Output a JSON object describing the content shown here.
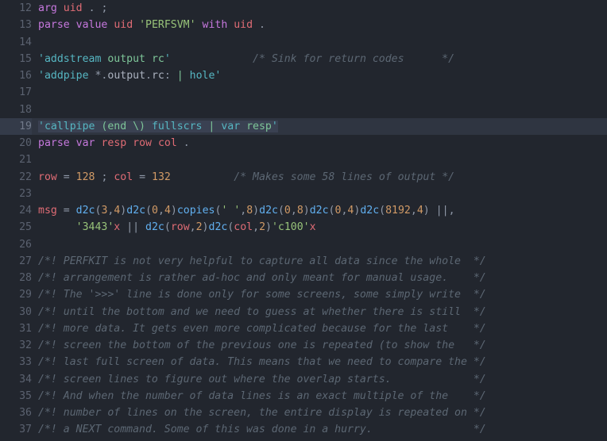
{
  "editor": {
    "theme": "one-dark",
    "background": "#22262e",
    "current_line_background": "#2f3541",
    "gutter_color": "#5b6270",
    "first_visible_line": 12,
    "last_visible_line": 37,
    "current_line": 19,
    "colors": {
      "keyword": "#c678dd",
      "variable": "#e06c75",
      "string": "#98c379",
      "string_cmd": "#56b6c2",
      "number": "#d19a66",
      "function": "#61afef",
      "operator": "#9099a8",
      "comment": "#5c6773",
      "plain": "#abb2bf"
    }
  },
  "lines": [
    {
      "number": "12",
      "current": false,
      "tokens": [
        {
          "t": "arg",
          "c": "t-kw"
        },
        {
          "t": " ",
          "c": "t-plain"
        },
        {
          "t": "uid",
          "c": "t-var"
        },
        {
          "t": " ",
          "c": "t-plain"
        },
        {
          "t": ".",
          "c": "t-punc"
        },
        {
          "t": " ",
          "c": "t-plain"
        },
        {
          "t": ";",
          "c": "t-punc"
        }
      ]
    },
    {
      "number": "13",
      "current": false,
      "tokens": [
        {
          "t": "parse",
          "c": "t-kw"
        },
        {
          "t": " ",
          "c": "t-plain"
        },
        {
          "t": "value",
          "c": "t-kw"
        },
        {
          "t": " ",
          "c": "t-plain"
        },
        {
          "t": "uid",
          "c": "t-var"
        },
        {
          "t": " ",
          "c": "t-plain"
        },
        {
          "t": "'PERFSVM'",
          "c": "t-str"
        },
        {
          "t": " ",
          "c": "t-plain"
        },
        {
          "t": "with",
          "c": "t-kw"
        },
        {
          "t": " ",
          "c": "t-plain"
        },
        {
          "t": "uid",
          "c": "t-var"
        },
        {
          "t": " ",
          "c": "t-plain"
        },
        {
          "t": ".",
          "c": "t-punc"
        }
      ]
    },
    {
      "number": "14",
      "current": false,
      "tokens": []
    },
    {
      "number": "15",
      "current": false,
      "tokens": [
        {
          "t": "'addstream ",
          "c": "t-strc"
        },
        {
          "t": "output",
          "c": "t-grn"
        },
        {
          "t": " ",
          "c": "t-strc"
        },
        {
          "t": "rc",
          "c": "t-grn"
        },
        {
          "t": "'",
          "c": "t-strc"
        },
        {
          "t": "             ",
          "c": "t-plain"
        },
        {
          "t": "/* Sink for return codes      */",
          "c": "t-cmt"
        }
      ]
    },
    {
      "number": "16",
      "current": false,
      "tokens": [
        {
          "t": "'addpipe ",
          "c": "t-strc"
        },
        {
          "t": "*",
          "c": "t-op"
        },
        {
          "t": ".",
          "c": "t-op"
        },
        {
          "t": "output",
          "c": "t-plain"
        },
        {
          "t": ".",
          "c": "t-op"
        },
        {
          "t": "rc",
          "c": "t-plain"
        },
        {
          "t": ": ",
          "c": "t-op"
        },
        {
          "t": "|",
          "c": "t-grn"
        },
        {
          "t": " ",
          "c": "t-strc"
        },
        {
          "t": "hole",
          "c": "t-strc"
        },
        {
          "t": "'",
          "c": "t-strc"
        }
      ]
    },
    {
      "number": "17",
      "current": false,
      "tokens": []
    },
    {
      "number": "18",
      "current": false,
      "tokens": []
    },
    {
      "number": "19",
      "current": true,
      "tokens": [
        {
          "t": "'callpipe ",
          "c": "t-strc sel"
        },
        {
          "t": "(end \\)",
          "c": "t-grn sel"
        },
        {
          "t": " ",
          "c": "t-strc sel"
        },
        {
          "t": "fullscrs",
          "c": "t-strc sel"
        },
        {
          "t": " ",
          "c": "t-strc sel"
        },
        {
          "t": "|",
          "c": "t-grn sel"
        },
        {
          "t": " ",
          "c": "t-strc sel"
        },
        {
          "t": "var",
          "c": "t-strc sel"
        },
        {
          "t": " ",
          "c": "t-strc sel"
        },
        {
          "t": "resp",
          "c": "t-grn sel"
        },
        {
          "t": "'",
          "c": "t-strc sel"
        }
      ]
    },
    {
      "number": "20",
      "current": false,
      "tokens": [
        {
          "t": "parse",
          "c": "t-kw"
        },
        {
          "t": " ",
          "c": "t-plain"
        },
        {
          "t": "var",
          "c": "t-kw"
        },
        {
          "t": " ",
          "c": "t-plain"
        },
        {
          "t": "resp",
          "c": "t-var"
        },
        {
          "t": " ",
          "c": "t-plain"
        },
        {
          "t": "row",
          "c": "t-var"
        },
        {
          "t": " ",
          "c": "t-plain"
        },
        {
          "t": "col",
          "c": "t-var"
        },
        {
          "t": " ",
          "c": "t-plain"
        },
        {
          "t": ".",
          "c": "t-punc"
        }
      ]
    },
    {
      "number": "21",
      "current": false,
      "tokens": []
    },
    {
      "number": "22",
      "current": false,
      "tokens": [
        {
          "t": "row",
          "c": "t-var"
        },
        {
          "t": " = ",
          "c": "t-op"
        },
        {
          "t": "128",
          "c": "t-num"
        },
        {
          "t": " ",
          "c": "t-plain"
        },
        {
          "t": ";",
          "c": "t-punc"
        },
        {
          "t": " ",
          "c": "t-plain"
        },
        {
          "t": "col",
          "c": "t-var"
        },
        {
          "t": " = ",
          "c": "t-op"
        },
        {
          "t": "132",
          "c": "t-num"
        },
        {
          "t": "          ",
          "c": "t-plain"
        },
        {
          "t": "/* Makes some 58 lines of output */",
          "c": "t-cmt"
        }
      ]
    },
    {
      "number": "23",
      "current": false,
      "tokens": []
    },
    {
      "number": "24",
      "current": false,
      "tokens": [
        {
          "t": "msg",
          "c": "t-var"
        },
        {
          "t": " = ",
          "c": "t-op"
        },
        {
          "t": "d2c",
          "c": "t-fn"
        },
        {
          "t": "(",
          "c": "t-punc"
        },
        {
          "t": "3",
          "c": "t-num"
        },
        {
          "t": ",",
          "c": "t-punc"
        },
        {
          "t": "4",
          "c": "t-num"
        },
        {
          "t": ")",
          "c": "t-punc"
        },
        {
          "t": "d2c",
          "c": "t-fn"
        },
        {
          "t": "(",
          "c": "t-punc"
        },
        {
          "t": "0",
          "c": "t-num"
        },
        {
          "t": ",",
          "c": "t-punc"
        },
        {
          "t": "4",
          "c": "t-num"
        },
        {
          "t": ")",
          "c": "t-punc"
        },
        {
          "t": "copies",
          "c": "t-fn"
        },
        {
          "t": "(",
          "c": "t-punc"
        },
        {
          "t": "' '",
          "c": "t-str"
        },
        {
          "t": ",",
          "c": "t-punc"
        },
        {
          "t": "8",
          "c": "t-num"
        },
        {
          "t": ")",
          "c": "t-punc"
        },
        {
          "t": "d2c",
          "c": "t-fn"
        },
        {
          "t": "(",
          "c": "t-punc"
        },
        {
          "t": "0",
          "c": "t-num"
        },
        {
          "t": ",",
          "c": "t-punc"
        },
        {
          "t": "8",
          "c": "t-num"
        },
        {
          "t": ")",
          "c": "t-punc"
        },
        {
          "t": "d2c",
          "c": "t-fn"
        },
        {
          "t": "(",
          "c": "t-punc"
        },
        {
          "t": "0",
          "c": "t-num"
        },
        {
          "t": ",",
          "c": "t-punc"
        },
        {
          "t": "4",
          "c": "t-num"
        },
        {
          "t": ")",
          "c": "t-punc"
        },
        {
          "t": "d2c",
          "c": "t-fn"
        },
        {
          "t": "(",
          "c": "t-punc"
        },
        {
          "t": "8192",
          "c": "t-num"
        },
        {
          "t": ",",
          "c": "t-punc"
        },
        {
          "t": "4",
          "c": "t-num"
        },
        {
          "t": ")",
          "c": "t-punc"
        },
        {
          "t": " ",
          "c": "t-plain"
        },
        {
          "t": "||",
          "c": "t-op"
        },
        {
          "t": ",",
          "c": "t-punc"
        }
      ]
    },
    {
      "number": "25",
      "current": false,
      "tokens": [
        {
          "t": "      ",
          "c": "t-plain"
        },
        {
          "t": "'3443'",
          "c": "t-str"
        },
        {
          "t": "x",
          "c": "t-var"
        },
        {
          "t": " ",
          "c": "t-plain"
        },
        {
          "t": "||",
          "c": "t-op"
        },
        {
          "t": " ",
          "c": "t-plain"
        },
        {
          "t": "d2c",
          "c": "t-fn"
        },
        {
          "t": "(",
          "c": "t-punc"
        },
        {
          "t": "row",
          "c": "t-var"
        },
        {
          "t": ",",
          "c": "t-punc"
        },
        {
          "t": "2",
          "c": "t-num"
        },
        {
          "t": ")",
          "c": "t-punc"
        },
        {
          "t": "d2c",
          "c": "t-fn"
        },
        {
          "t": "(",
          "c": "t-punc"
        },
        {
          "t": "col",
          "c": "t-var"
        },
        {
          "t": ",",
          "c": "t-punc"
        },
        {
          "t": "2",
          "c": "t-num"
        },
        {
          "t": ")",
          "c": "t-punc"
        },
        {
          "t": "'c100'",
          "c": "t-str"
        },
        {
          "t": "x",
          "c": "t-var"
        }
      ]
    },
    {
      "number": "26",
      "current": false,
      "tokens": []
    },
    {
      "number": "27",
      "current": false,
      "tokens": [
        {
          "t": "/*! PERFKIT is not very helpful to capture all data since the whole  */",
          "c": "t-cmt"
        }
      ]
    },
    {
      "number": "28",
      "current": false,
      "tokens": [
        {
          "t": "/*! arrangement is rather ad-hoc and only meant for manual usage.    */",
          "c": "t-cmt"
        }
      ]
    },
    {
      "number": "29",
      "current": false,
      "tokens": [
        {
          "t": "/*! The '>>>' line is done only for some screens, some simply write  */",
          "c": "t-cmt"
        }
      ]
    },
    {
      "number": "30",
      "current": false,
      "tokens": [
        {
          "t": "/*! until the bottom and we need to guess at whether there is still  */",
          "c": "t-cmt"
        }
      ]
    },
    {
      "number": "31",
      "current": false,
      "tokens": [
        {
          "t": "/*! more data. It gets even more complicated because for the last    */",
          "c": "t-cmt"
        }
      ]
    },
    {
      "number": "32",
      "current": false,
      "tokens": [
        {
          "t": "/*! screen the bottom of the previous one is repeated (to show the   */",
          "c": "t-cmt"
        }
      ]
    },
    {
      "number": "33",
      "current": false,
      "tokens": [
        {
          "t": "/*! last full screen of data. This means that we need to compare the */",
          "c": "t-cmt"
        }
      ]
    },
    {
      "number": "34",
      "current": false,
      "tokens": [
        {
          "t": "/*! screen lines to figure out where the overlap starts.             */",
          "c": "t-cmt"
        }
      ]
    },
    {
      "number": "35",
      "current": false,
      "tokens": [
        {
          "t": "/*! And when the number of data lines is an exact multiple of the    */",
          "c": "t-cmt"
        }
      ]
    },
    {
      "number": "36",
      "current": false,
      "tokens": [
        {
          "t": "/*! number of lines on the screen, the entire display is repeated on */",
          "c": "t-cmt"
        }
      ]
    },
    {
      "number": "37",
      "current": false,
      "tokens": [
        {
          "t": "/*! a NEXT command. Some of this was done in a hurry.                */",
          "c": "t-cmt"
        }
      ]
    }
  ]
}
